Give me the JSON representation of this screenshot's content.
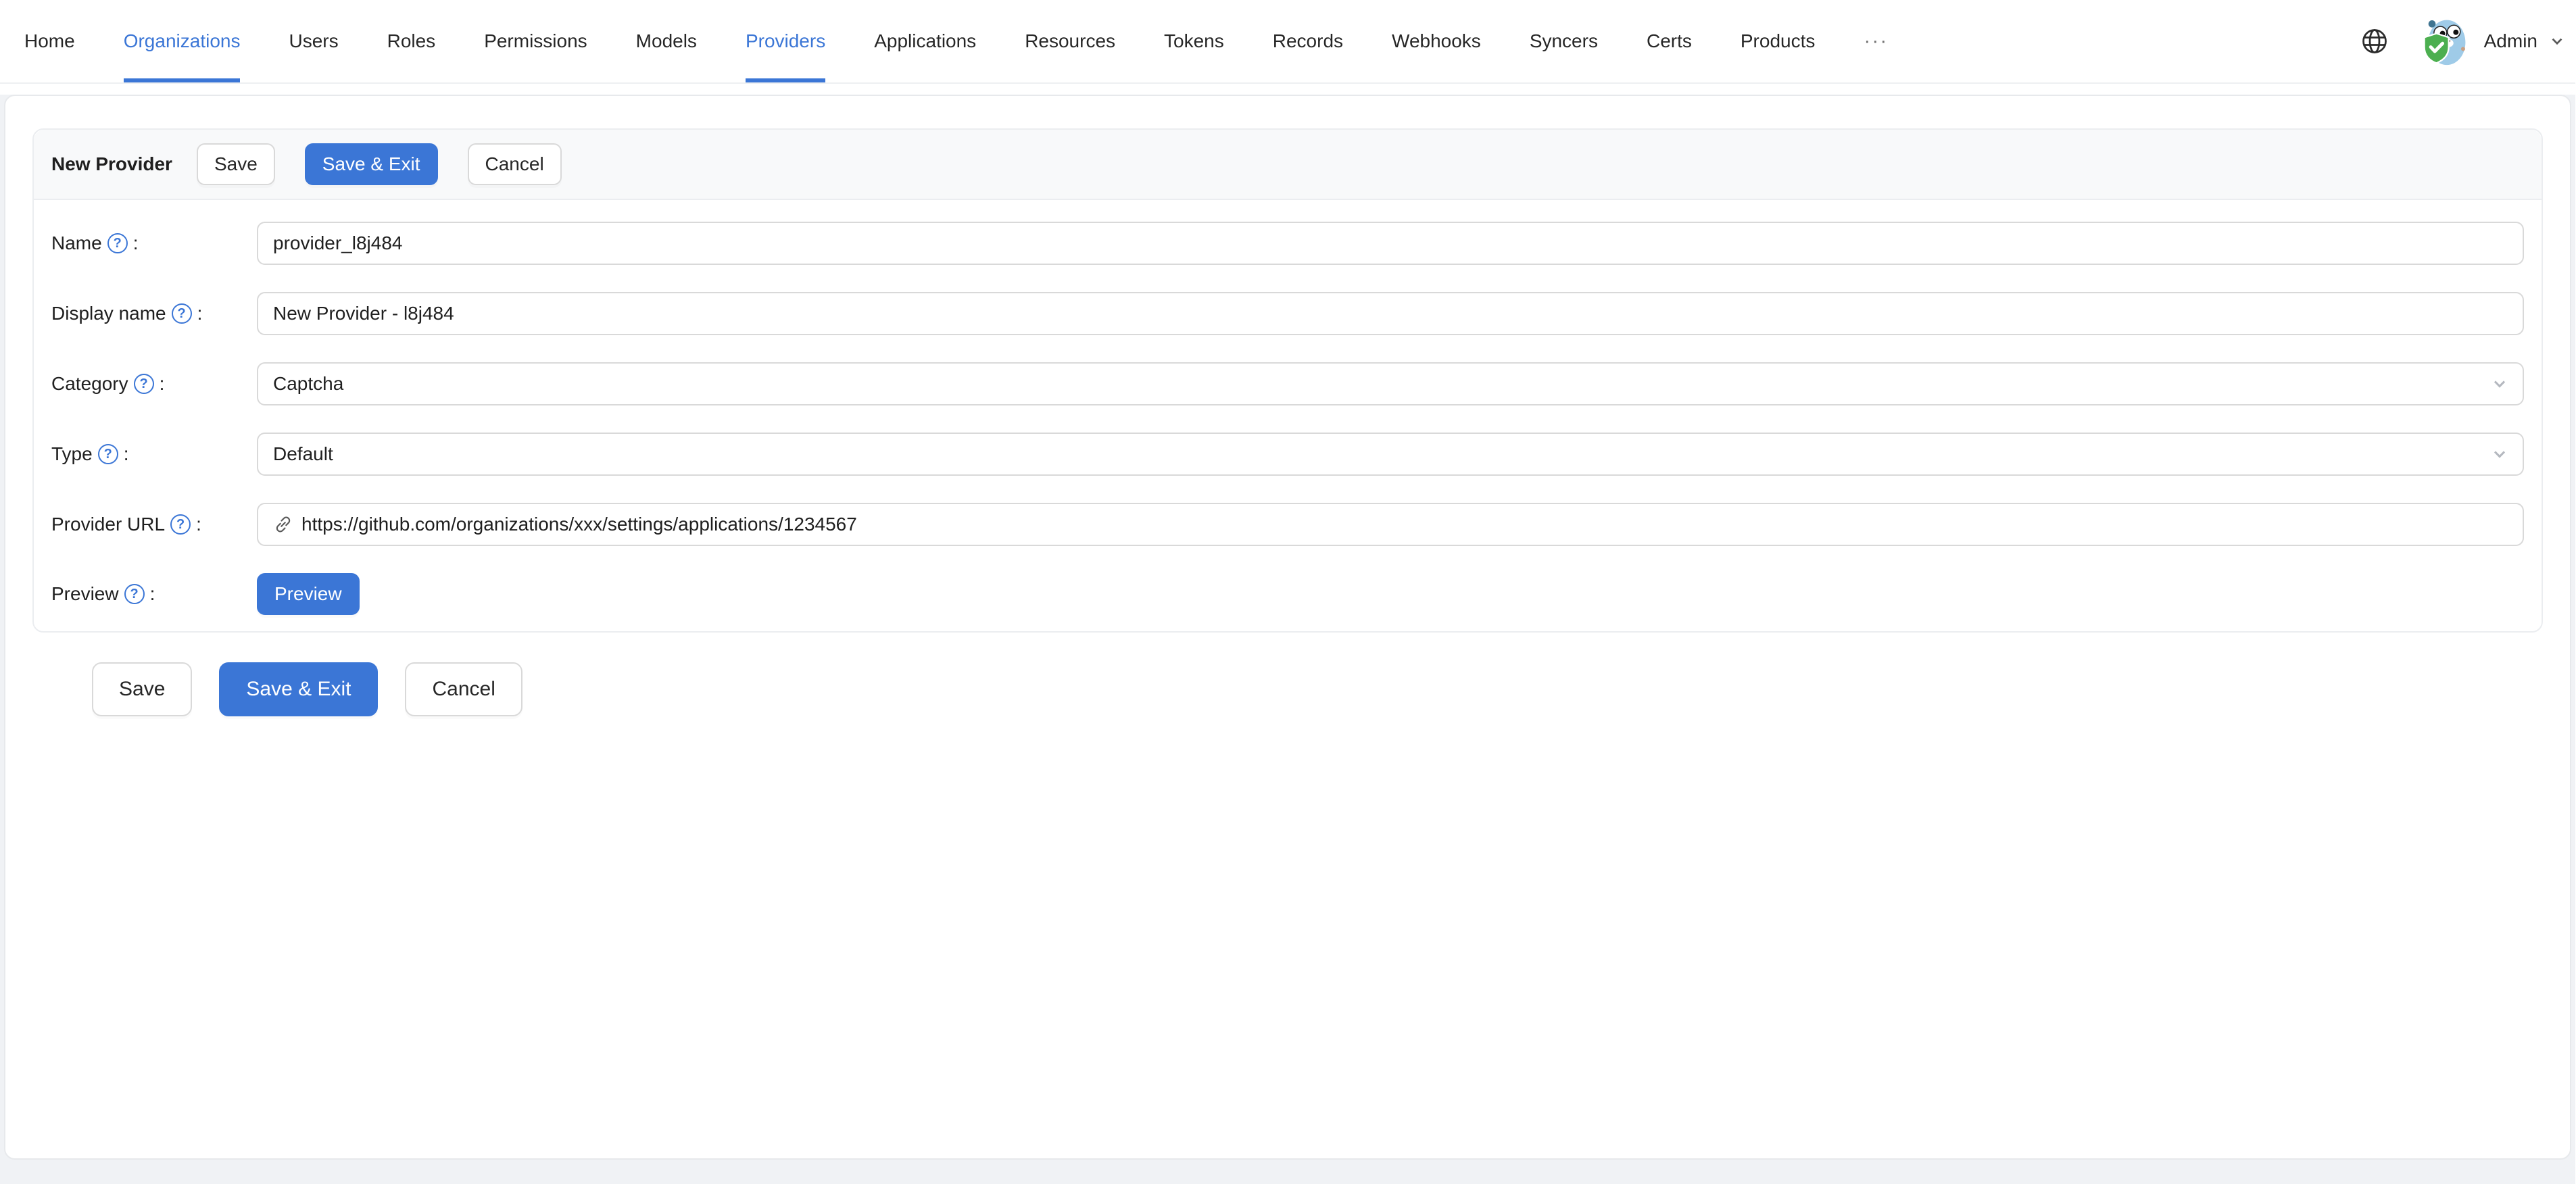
{
  "nav": {
    "items": [
      {
        "label": "Home",
        "active": false
      },
      {
        "label": "Organizations",
        "active": true
      },
      {
        "label": "Users",
        "active": false
      },
      {
        "label": "Roles",
        "active": false
      },
      {
        "label": "Permissions",
        "active": false
      },
      {
        "label": "Models",
        "active": false
      },
      {
        "label": "Providers",
        "active": true
      },
      {
        "label": "Applications",
        "active": false
      },
      {
        "label": "Resources",
        "active": false
      },
      {
        "label": "Tokens",
        "active": false
      },
      {
        "label": "Records",
        "active": false
      },
      {
        "label": "Webhooks",
        "active": false
      },
      {
        "label": "Syncers",
        "active": false
      },
      {
        "label": "Certs",
        "active": false
      },
      {
        "label": "Products",
        "active": false
      }
    ],
    "overflow_label": "···",
    "user": {
      "name": "Admin"
    }
  },
  "card": {
    "title": "New Provider"
  },
  "actions": {
    "save": "Save",
    "save_and_exit": "Save & Exit",
    "cancel": "Cancel"
  },
  "form": {
    "label_suffix": ":",
    "fields": [
      {
        "label": "Name",
        "value": "provider_l8j484"
      },
      {
        "label": "Display name",
        "value": "New Provider - l8j484"
      },
      {
        "label": "Category",
        "value": "Captcha"
      },
      {
        "label": "Type",
        "value": "Default"
      },
      {
        "label": "Provider URL",
        "value": "https://github.com/organizations/xxx/settings/applications/1234567"
      },
      {
        "label": "Preview",
        "button_label": "Preview"
      }
    ]
  },
  "colors": {
    "accent": "#3b76d6",
    "page_background": "#f0f2f5",
    "card_head_background": "#f8f9fa",
    "card_border": "#ebedf0",
    "input_border": "#d9d9d9"
  }
}
